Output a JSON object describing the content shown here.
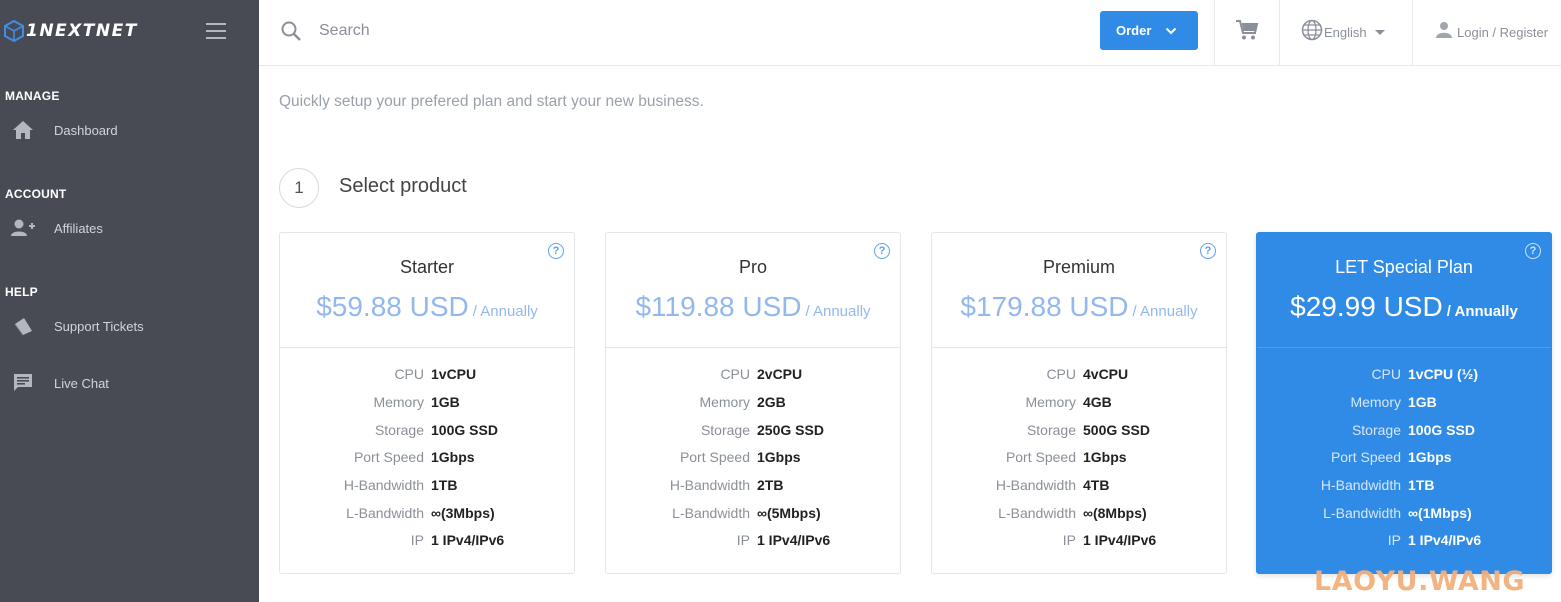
{
  "brand": {
    "name": "1NEXTNET"
  },
  "sidebar": {
    "sections": [
      {
        "title": "MANAGE",
        "items": [
          {
            "label": "Dashboard",
            "icon": "home-icon"
          }
        ]
      },
      {
        "title": "ACCOUNT",
        "items": [
          {
            "label": "Affiliates",
            "icon": "user-plus-icon"
          }
        ]
      },
      {
        "title": "HELP",
        "items": [
          {
            "label": "Support Tickets",
            "icon": "ticket-icon"
          },
          {
            "label": "Live Chat",
            "icon": "chat-icon"
          }
        ]
      }
    ]
  },
  "topbar": {
    "search_placeholder": "Search",
    "order_label": "Order",
    "language_label": "English",
    "login_label": "Login / Register"
  },
  "main": {
    "subtitle": "Quickly setup your prefered plan and start your new business.",
    "step_number": "1",
    "step_title": "Select product"
  },
  "spec_labels": [
    "CPU",
    "Memory",
    "Storage",
    "Port Speed",
    "H-Bandwidth",
    "L-Bandwidth",
    "IP"
  ],
  "plans": [
    {
      "name": "Starter",
      "price": "$59.88 USD",
      "period": "/ Annually",
      "help": "?",
      "specs": [
        "1vCPU",
        "1GB",
        "100G SSD",
        "1Gbps",
        "1TB",
        "∞(3Mbps)",
        "1 IPv4/IPv6"
      ]
    },
    {
      "name": "Pro",
      "price": "$119.88 USD",
      "period": "/ Annually",
      "help": "?",
      "specs": [
        "2vCPU",
        "2GB",
        "250G SSD",
        "1Gbps",
        "2TB",
        "∞(5Mbps)",
        "1 IPv4/IPv6"
      ]
    },
    {
      "name": "Premium",
      "price": "$179.88 USD",
      "period": "/ Annually",
      "help": "?",
      "specs": [
        "4vCPU",
        "4GB",
        "500G SSD",
        "1Gbps",
        "4TB",
        "∞(8Mbps)",
        "1 IPv4/IPv6"
      ]
    },
    {
      "name": "LET Special Plan",
      "price": "$29.99 USD",
      "period": "/ Annually",
      "help": "?",
      "featured": true,
      "specs": [
        "1vCPU (½)",
        "1GB",
        "100G SSD",
        "1Gbps",
        "1TB",
        "∞(1Mbps)",
        "1 IPv4/IPv6"
      ]
    }
  ],
  "watermark": "LAOYU.WANG",
  "colors": {
    "sidebar": "#484b54",
    "accent": "#2f8be6",
    "price_light": "#93b8ee"
  }
}
